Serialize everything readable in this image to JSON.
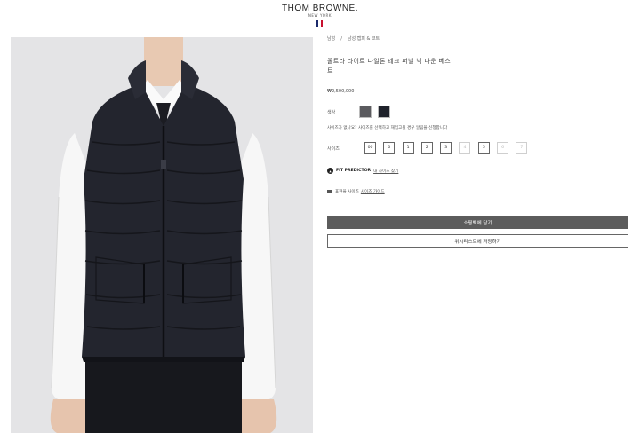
{
  "header": {
    "brand": "THOM BROWNE.",
    "brand_sub": "NEW YORK",
    "flag_colors": [
      "#1b2a6b",
      "#ffffff",
      "#c8102e"
    ]
  },
  "product_image": {
    "icon": "down-vest-photo",
    "background": "#e4e4e6"
  },
  "breadcrumb": {
    "items": [
      "남성",
      "남성 캡피 & 코트"
    ],
    "separator": "/"
  },
  "product": {
    "title": "울트라 라이트 나일론 테크 퍼넬 넥 다운 베스트",
    "price": "₩2,500,000"
  },
  "color": {
    "label": "색상",
    "swatches": [
      {
        "name": "grey",
        "hex": "#5b5b5f"
      },
      {
        "name": "navy",
        "hex": "#1f222b"
      }
    ]
  },
  "size": {
    "note": "사이즈가 없나요? 사이즈를 선택하고 재입고될 경우 알림을 신청합니다",
    "label": "사이즈",
    "options": [
      {
        "label": "00",
        "available": true
      },
      {
        "label": "0",
        "available": true
      },
      {
        "label": "1",
        "available": true
      },
      {
        "label": "2",
        "available": true
      },
      {
        "label": "3",
        "available": true
      },
      {
        "label": "4",
        "available": false
      },
      {
        "label": "5",
        "available": true
      },
      {
        "label": "6",
        "available": false
      },
      {
        "label": "7",
        "available": false
      }
    ]
  },
  "fit_predictor": {
    "icon": "fit-predictor-icon",
    "label": "FIT PREDICTOR",
    "link": "내 사이즈 찾기"
  },
  "size_guide": {
    "icon": "ruler-icon",
    "text": "표현을 사이즈",
    "link": "사이즈 가이드"
  },
  "actions": {
    "add_to_cart": "쇼핑백에 담기",
    "save_wishlist": "위시리스트에 저장하기",
    "cart_bg": "#5c5c5c"
  }
}
